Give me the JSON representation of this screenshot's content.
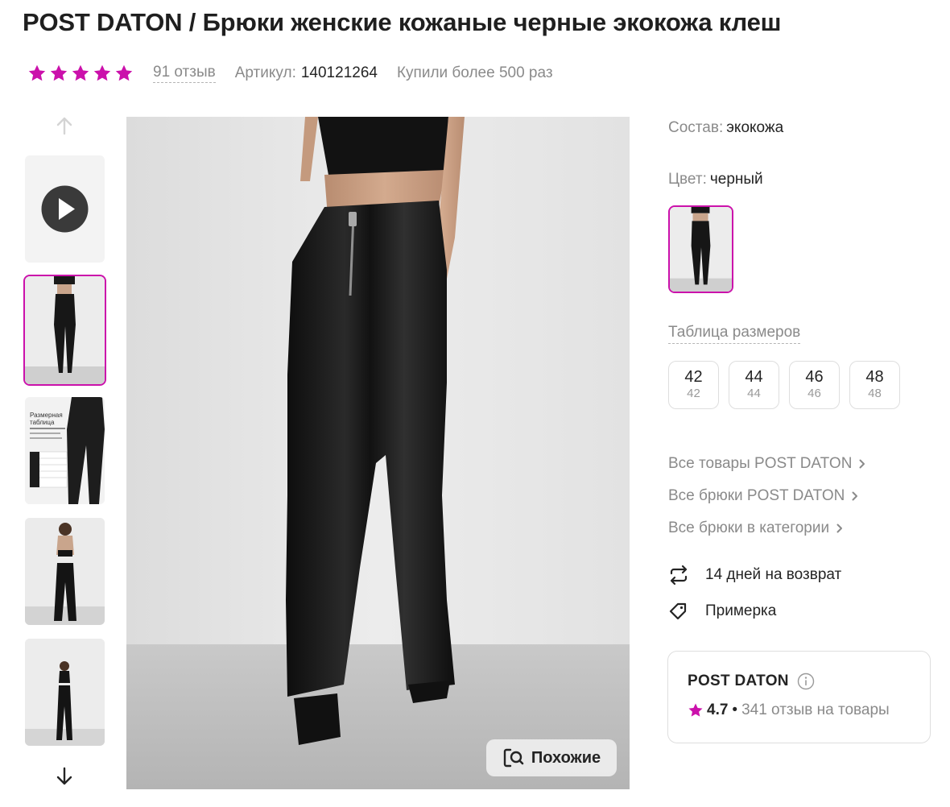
{
  "product": {
    "title": "POST DATON / Брюки женские кожаные черные экокожа клеш",
    "rating_stars": 5,
    "reviews": "91 отзыв",
    "article_label": "Артикул:",
    "article_value": "140121264",
    "bought": "Купили более 500 раз"
  },
  "gallery": {
    "thumbnails": [
      "video",
      "photo-front",
      "size-chart",
      "photo-model",
      "photo-full"
    ],
    "active_index": 1,
    "size_chart_thumb_text": "Размерная таблица",
    "similar_button": "Похожие"
  },
  "details": {
    "composition_label": "Состав:",
    "composition_value": "экокожа",
    "color_label": "Цвет:",
    "color_value": "черный",
    "size_table_link": "Таблица размеров",
    "sizes": [
      {
        "main": "42",
        "sub": "42"
      },
      {
        "main": "44",
        "sub": "44"
      },
      {
        "main": "46",
        "sub": "46"
      },
      {
        "main": "48",
        "sub": "48"
      }
    ]
  },
  "links": [
    "Все товары POST DATON",
    "Все брюки POST DATON",
    "Все брюки в категории"
  ],
  "features": {
    "return": "14 дней на возврат",
    "fitting": "Примерка"
  },
  "brand": {
    "name": "POST DATON",
    "rating": "4.7",
    "reviews": "341 отзыв на товары"
  },
  "colors": {
    "accent": "#cb11ab",
    "muted_text": "#8a8a8a",
    "text": "#242424"
  }
}
